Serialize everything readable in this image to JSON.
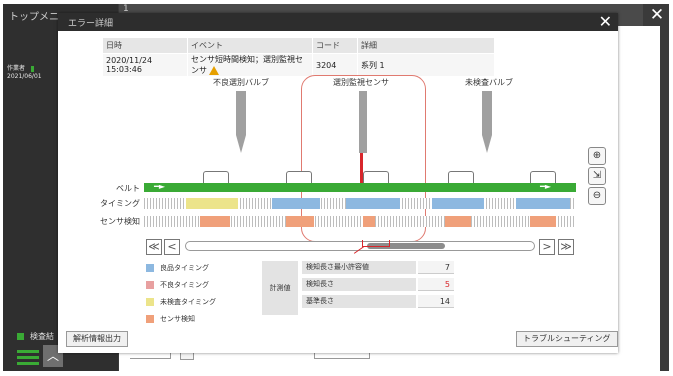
{
  "background": {
    "left_title": "トップメニュー",
    "operator_label": "作業者",
    "date_partial": "2021/06/01",
    "tab_label": "1",
    "status_label": "検査結",
    "close_symbol": "✕"
  },
  "dialog": {
    "title": "エラー詳細",
    "close_symbol": "✕"
  },
  "event_table": {
    "headers": [
      "日時",
      "イベント",
      "コード",
      "詳細"
    ],
    "row": [
      "2020/11/24 15:03:46",
      "センサ短時間検知；選別監視センサ",
      "3204",
      "系列 1"
    ]
  },
  "diagram": {
    "valve_left": "不良選別バルブ",
    "sensor": "選別監視センサ",
    "valve_right": "未検査バルブ",
    "row_labels": {
      "belt": "ベルト",
      "timing": "タイミング",
      "sensor": "センサ検知"
    }
  },
  "legend": [
    {
      "label": "良品タイミング",
      "color": "#8db8e0"
    },
    {
      "label": "不良タイミング",
      "color": "#e8a0a0"
    },
    {
      "label": "未検査タイミング",
      "color": "#ece48a"
    },
    {
      "label": "センサ検知",
      "color": "#f0a07a"
    }
  ],
  "measurement": {
    "heading": "計測値",
    "rows": [
      {
        "name": "検知長さ最小許容値",
        "value": "7"
      },
      {
        "name": "検知長さ",
        "value": "5"
      },
      {
        "name": "基準長さ",
        "value": "14"
      }
    ]
  },
  "scroll": {
    "first": "≪",
    "prev": "<",
    "next": ">",
    "last": "≫"
  },
  "zoom": {
    "zoom_in": "⊕",
    "fit": "⇲",
    "zoom_out": "⊖"
  },
  "buttons": {
    "analysis": "解析情報出力",
    "troubleshooting": "トラブルシューティング"
  },
  "colors": {
    "belt": "#3aaa35",
    "alert": "#d8262b",
    "good": "#8db8e0",
    "bad": "#e8a0a0",
    "uninspected": "#ece48a",
    "sensor_detect": "#f0a07a",
    "dialog_title": "#2d2d2d"
  }
}
